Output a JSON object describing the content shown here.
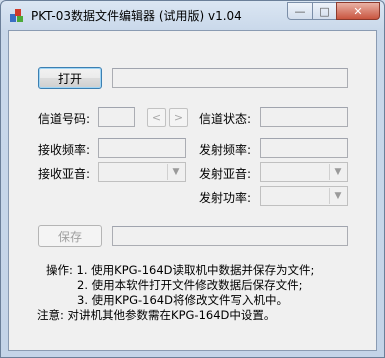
{
  "window": {
    "title": "PKT-03数据文件编辑器 (试用版) v1.04",
    "minimize_icon": "minimize-icon",
    "maximize_icon": "maximize-icon",
    "close_icon": "close-icon",
    "minimize_glyph": "—",
    "maximize_glyph": "□",
    "close_glyph": "✕"
  },
  "file": {
    "open_label": "打开",
    "path_value": "",
    "save_label": "保存",
    "save_path_value": ""
  },
  "channel": {
    "number_label": "信道号码:",
    "number_value": "",
    "prev_glyph": "<",
    "next_glyph": ">",
    "status_label": "信道状态:",
    "status_value": "",
    "rx_freq_label": "接收频率:",
    "rx_freq_value": "",
    "tx_freq_label": "发射频率:",
    "tx_freq_value": "",
    "rx_ctcss_label": "接收亚音:",
    "rx_ctcss_value": "",
    "tx_ctcss_label": "发射亚音:",
    "tx_ctcss_value": "",
    "tx_power_label": "发射功率:",
    "tx_power_value": "",
    "dropdown_glyph": "▼"
  },
  "notes": {
    "line1": "操作: 1. 使用KPG-164D读取机中数据并保存为文件;",
    "line2": "2. 使用本软件打开文件修改数据后保存文件;",
    "line3": "3. 使用KPG-164D将修改文件写入机中。",
    "line4": "注意: 对讲机其他参数需在KPG-164D中设置。"
  }
}
